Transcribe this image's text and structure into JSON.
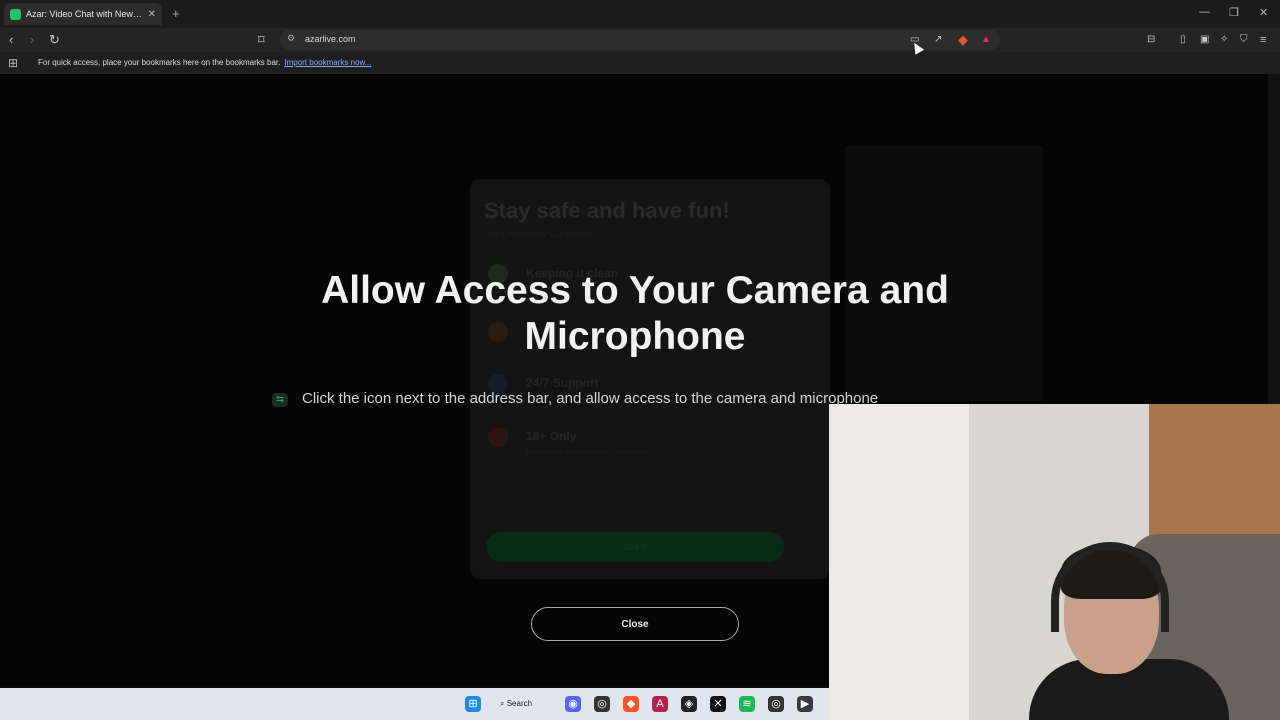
{
  "browser": {
    "tab_title": "Azar: Video Chat with New People",
    "new_tab": "+",
    "url": "azarlive.com",
    "bookmarks_message": "For quick access, place your bookmarks here on the bookmarks bar.",
    "bookmarks_link": "Import bookmarks now..."
  },
  "background_site": {
    "card_title": "Stay safe and have fun!",
    "card_subtitle": "Our Community Guidelines",
    "rows": [
      {
        "title": "Keeping it clean"
      },
      {
        "title": "24/7 Support"
      },
      {
        "title": "18+ Only",
        "detail": "Minors are not allowed to use Azar"
      }
    ],
    "button": "Got it"
  },
  "dialog": {
    "headline": "Allow Access to Your Camera and Microphone",
    "instruction": "Click the icon next to the address bar, and allow access to the camera and microphone",
    "close_label": "Close"
  },
  "taskbar": {
    "search_label": "Search"
  },
  "colors": {
    "accent_green": "#27c26b",
    "link_blue": "#7fb0ff"
  }
}
